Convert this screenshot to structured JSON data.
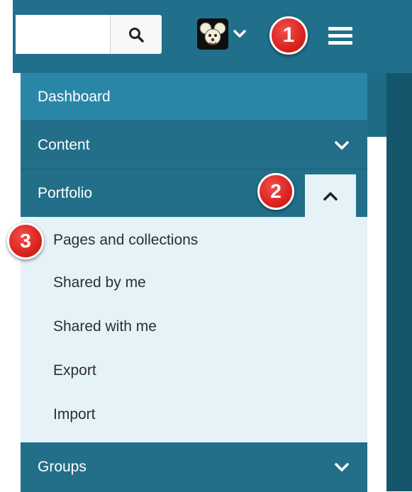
{
  "header": {
    "search": {
      "value": "",
      "placeholder": ""
    },
    "search_button_icon": "search-icon",
    "avatar_icon": "mouse-avatar",
    "user_menu_chevron": "chevron-down-icon",
    "menu_icon": "hamburger-icon"
  },
  "annotations": [
    "1",
    "2",
    "3"
  ],
  "nav": {
    "dashboard": "Dashboard",
    "content": "Content",
    "portfolio": "Portfolio",
    "portfolio_items": [
      "Pages and collections",
      "Shared by me",
      "Shared with me",
      "Export",
      "Import"
    ],
    "groups": "Groups"
  },
  "colors": {
    "header_bg": "#20708c",
    "menu_active": "#2a86a6",
    "menu_bg": "#236f8a",
    "submenu_bg": "#e5f3f8",
    "badge_red": "#d9241f"
  }
}
